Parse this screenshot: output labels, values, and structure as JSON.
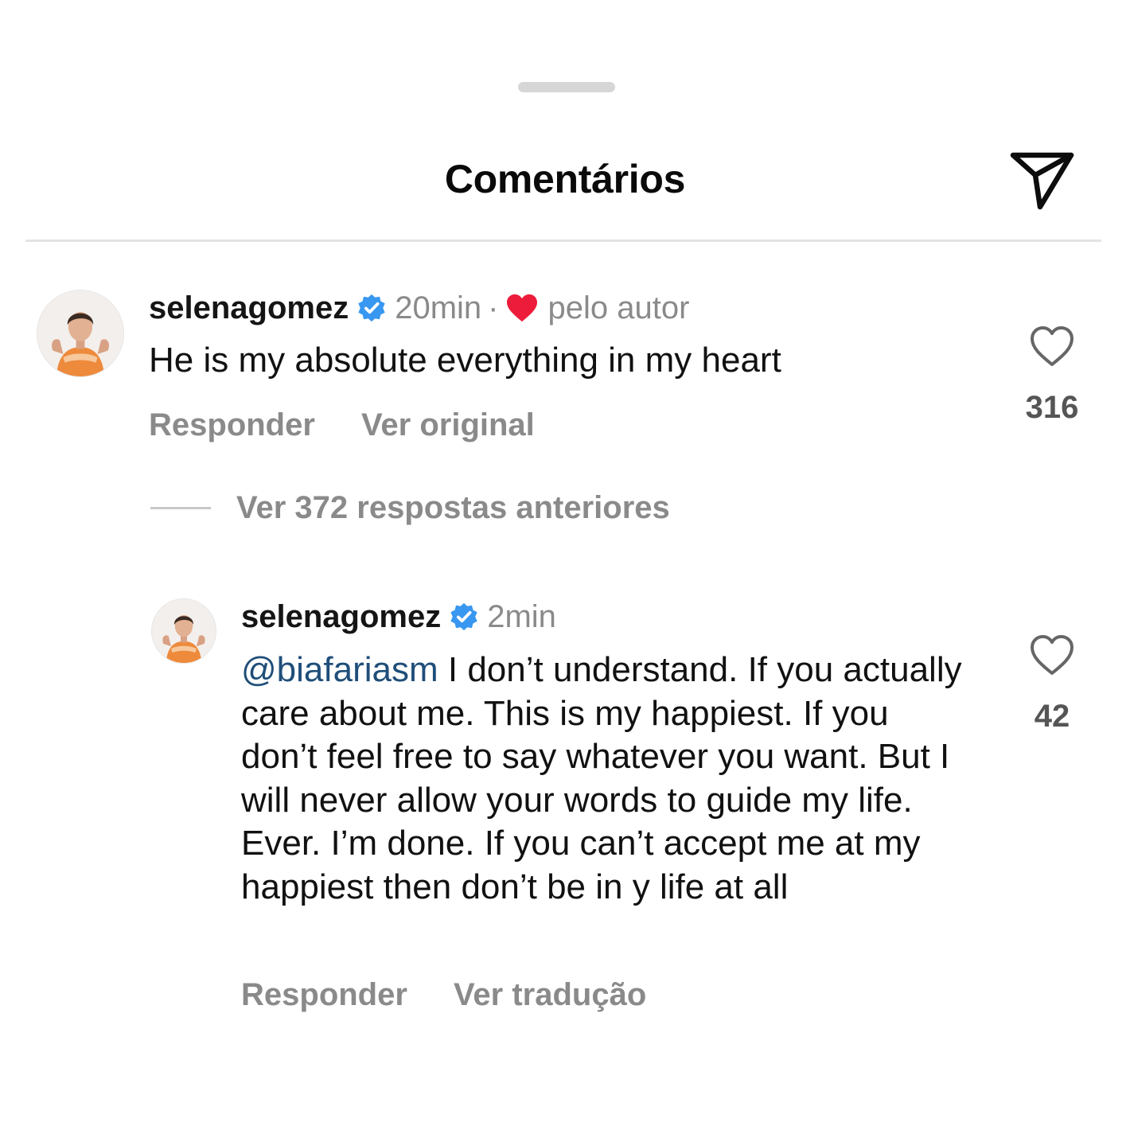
{
  "sheet": {
    "title": "Comentários",
    "share_icon": "send-paper-plane-icon"
  },
  "comments": [
    {
      "username": "selenagomez",
      "verified": true,
      "time": "20min",
      "separator": "·",
      "liked_by_author": "pelo autor",
      "text": "He is my absolute everything in my heart",
      "actions": {
        "reply": "Responder",
        "secondary": "Ver original"
      },
      "likes": "316"
    }
  ],
  "replies_toggle": {
    "label": "Ver 372 respostas anteriores"
  },
  "replies": [
    {
      "username": "selenagomez",
      "verified": true,
      "time": "2min",
      "mention": "@biafariasm",
      "text": " I don’t understand. If you actually care about me. This is my happiest. If you don’t feel free to say whatever you want. But I will never allow your words to guide my life. Ever. I’m done. If you can’t accept me at my happiest then don’t be in y life at all",
      "actions": {
        "reply": "Responder",
        "secondary": "Ver tradução"
      },
      "likes": "42"
    }
  ],
  "colors": {
    "verified_badge": "#3897f0",
    "author_heart": "#ed1c3a",
    "mention": "#1f4e79",
    "secondary_text": "#8a8a8a"
  }
}
